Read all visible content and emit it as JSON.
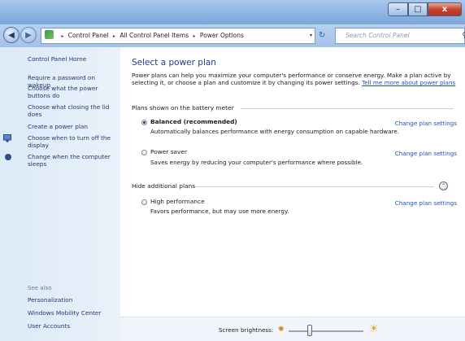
{
  "window": {
    "controls": {
      "minimize": "–",
      "maximize": "□",
      "close": "x"
    }
  },
  "nav": {
    "back_icon": "◀",
    "forward_icon": "▶",
    "breadcrumb": [
      "Control Panel",
      "All Control Panel Items",
      "Power Options"
    ],
    "breadcrumb_sep": "▸",
    "dropdown": "▾",
    "refresh": "↻",
    "search_placeholder": "Search Control Panel",
    "search_icon": "⚲"
  },
  "sidebar": {
    "home": "Control Panel Home",
    "links": [
      "Require a password on wakeup",
      "Choose what the power buttons do",
      "Choose what closing the lid does",
      "Create a power plan",
      "Choose when to turn off the display",
      "Change when the computer sleeps"
    ],
    "see_also_title": "See also",
    "see_also": [
      "Personalization",
      "Windows Mobility Center",
      "User Accounts"
    ]
  },
  "main": {
    "title": "Select a power plan",
    "intro": "Power plans can help you maximize your computer's performance or conserve energy. Make a plan active by selecting it, or choose a plan and customize it by changing its power settings.",
    "intro_link": "Tell me more about power plans",
    "group_battery": "Plans shown on the battery meter",
    "group_hidden": "Hide additional plans",
    "change_label": "Change plan settings",
    "plans": [
      {
        "name": "Balanced (recommended)",
        "desc": "Automatically balances performance with energy consumption on capable hardware.",
        "selected": true
      },
      {
        "name": "Power saver",
        "desc": "Saves energy by reducing your computer's performance where possible.",
        "selected": false
      },
      {
        "name": "High performance",
        "desc": "Favors performance, but may use more energy.",
        "selected": false
      }
    ],
    "collapse_icon": "⌃"
  },
  "bottom": {
    "brightness_label": "Screen brightness:",
    "brightness_level": 0.28,
    "sun_small": "✺",
    "sun_big": "☀"
  }
}
